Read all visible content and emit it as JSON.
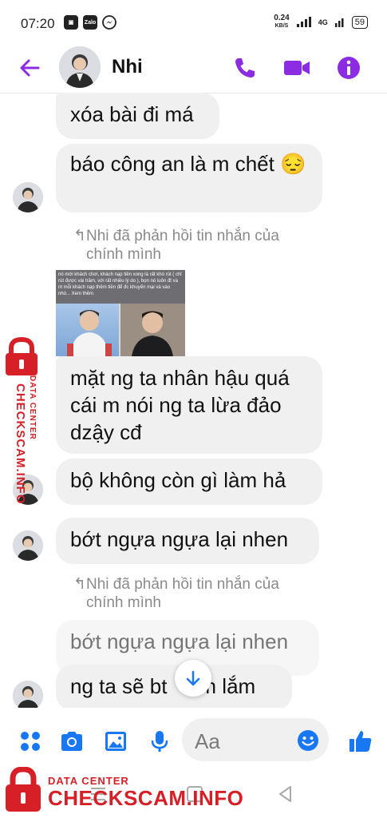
{
  "status": {
    "time": "07:20",
    "apps": [
      "app-icon",
      "Zalo",
      "messenger-icon"
    ],
    "net_speed": "0.24",
    "net_unit": "KB/S",
    "network": "4G",
    "battery": "59"
  },
  "header": {
    "contact_name": "Nhi",
    "accent": "#8b2be2"
  },
  "messages": [
    {
      "text": "xóa bài đi má"
    },
    {
      "text": "báo công an là m chết 😔"
    },
    {
      "reply_note": "Nhi đã phản hồi tin nhắn của chính mình"
    },
    {
      "photo_caption": "nó mới khách chơi, khách nạp tiền xong là rất khó rút ( chỉ rút được vài trăm, với rất nhiều lý do ), bọn nó luôn đt và nt mỗi khách nạp thêm tiền để đc khuyến mại và vào nhó... Xem thêm"
    },
    {
      "text": "mặt ng ta nhân hậu quá cái m nói ng ta lừa đảo dzậy cđ"
    },
    {
      "text": "bộ không còn gì làm hả"
    },
    {
      "text": "bớt ngựa ngựa lại nhen"
    },
    {
      "reply_note": "Nhi đã phản hồi tin nhắn của chính mình"
    },
    {
      "text": "bớt ngựa ngựa lại nhen"
    },
    {
      "text": "ng ta sẽ bt",
      "text_after": "m lắm"
    }
  ],
  "composer": {
    "placeholder": "Aa"
  },
  "watermark": {
    "small": "DATA CENTER",
    "big": "CHECKSCAM.INFO"
  },
  "colors": {
    "messenger_purple": "#8b2be2",
    "composer_blue": "#1877f2",
    "watermark_red": "#d61f26",
    "bubble_bg": "#f0f0f0"
  }
}
